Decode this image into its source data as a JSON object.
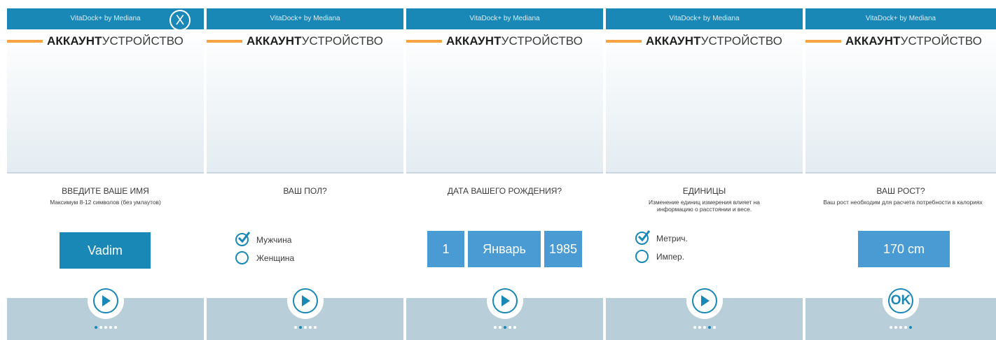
{
  "colors": {
    "brand_blue": "#1a88b7",
    "field_blue": "#4a9bd4",
    "accent_orange": "#f7a343",
    "footer": "#b8ced8"
  },
  "app_title": "VitaDock+ by Mediana",
  "tab_account": "АККАУНТ",
  "tab_device": "УСТРОЙСТВО",
  "close_label": "X",
  "screens": [
    {
      "question": "ВВЕДИТЕ ВАШЕ ИМЯ",
      "hint": "Максимум 8-12 символов (без умлаутов)",
      "name_value": "Vadim",
      "action_icon": "play-icon",
      "page_dots": 5,
      "current_page": 1
    },
    {
      "question": "ВАШ ПОЛ?",
      "options": [
        {
          "label": "Мужчина",
          "checked": true
        },
        {
          "label": "Женщина",
          "checked": false
        }
      ],
      "action_icon": "play-icon",
      "page_dots": 5,
      "current_page": 2
    },
    {
      "question": "ДАТА ВАШЕГО РОЖДЕНИЯ?",
      "day": "1",
      "month": "Январь",
      "year": "1985",
      "action_icon": "play-icon",
      "page_dots": 5,
      "current_page": 3
    },
    {
      "question": "ЕДИНИЦЫ",
      "hint": "Изменение единиц измерения влияет на информацию о расстоянии и весе.",
      "options": [
        {
          "label": "Метрич.",
          "checked": true
        },
        {
          "label": "Импер.",
          "checked": false
        }
      ],
      "action_icon": "play-icon",
      "page_dots": 5,
      "current_page": 4
    },
    {
      "question": "ВАШ РОСТ?",
      "hint": "Ваш рост необходим для расчета потребности в калориях",
      "height_value": "170 cm",
      "action_label": "OK",
      "page_dots": 5,
      "current_page": 5
    }
  ]
}
